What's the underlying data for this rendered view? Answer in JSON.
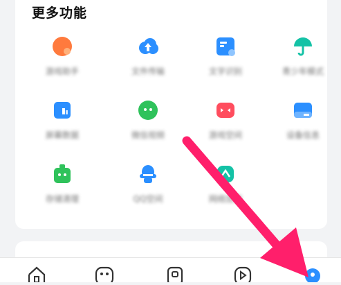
{
  "section": {
    "title": "更多功能"
  },
  "features": [
    {
      "label": "游戏助手",
      "icon": "game-icon",
      "color": "#ff7a3d"
    },
    {
      "label": "文件传输",
      "icon": "cloud-upload-icon",
      "color": "#2b8fff"
    },
    {
      "label": "文字识别",
      "icon": "doc-scan-icon",
      "color": "#2b8fff"
    },
    {
      "label": "青少年模式",
      "icon": "umbrella-icon",
      "color": "#14c2a6"
    },
    {
      "label": "屏幕数据",
      "icon": "stats-icon",
      "color": "#2b8fff"
    },
    {
      "label": "微信视频",
      "icon": "chat-bubble-icon",
      "color": "#2fc25b"
    },
    {
      "label": "游戏空间",
      "icon": "gamepad-icon",
      "color": "#ff4d5e"
    },
    {
      "label": "设备信息",
      "icon": "card-icon",
      "color": "#2b8fff"
    },
    {
      "label": "存储清理",
      "icon": "cleaner-icon",
      "color": "#2fc25b"
    },
    {
      "label": "QQ空间",
      "icon": "qq-icon",
      "color": "#2b8fff"
    },
    {
      "label": "网络加速",
      "icon": "speed-icon",
      "color": "#14c2a6"
    }
  ],
  "tabbar": {
    "tabs": [
      {
        "icon": "home-icon"
      },
      {
        "icon": "discover-icon"
      },
      {
        "icon": "video-icon"
      },
      {
        "icon": "play-icon"
      },
      {
        "icon": "profile-icon",
        "active": true,
        "color": "#2b8fff"
      }
    ]
  },
  "annotation": {
    "arrow_color": "#ff1f6b"
  }
}
